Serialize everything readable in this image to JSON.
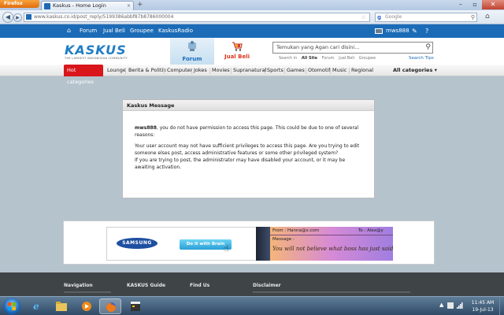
{
  "browser": {
    "menu_button": "Firefox",
    "tab_title": "Kaskus - Home Login",
    "tab_close": "×",
    "new_tab": "+",
    "url": "www.kaskus.co.id/post_reply/5199386abbf87b8786000004",
    "search_placeholder": "Google",
    "search_icon": "search-icon"
  },
  "kaskus": {
    "topnav": [
      "Forum",
      "Jual Beli",
      "Groupee",
      "KaskusRadio"
    ],
    "username": "mws888",
    "logo_text": "KASKUS",
    "logo_tagline": "THE LARGEST INDONESIAN COMMUNITY",
    "tab_forum": "Forum",
    "tab_jualbeli": "Jual Beli",
    "search_placeholder": "Temukan yang Agan cari disini...",
    "search_in_label": "Search in",
    "search_scopes": [
      "All Site",
      "Forum",
      "Jual Beli",
      "Groupee"
    ],
    "search_tips": "Search Tips",
    "hot_categories": "Hot categories",
    "categories": [
      "Lounge",
      "Berita & Politik",
      "Computer",
      "Jokes",
      "Movies",
      "Supranatural",
      "Sports",
      "Games",
      "Otomotif",
      "Music",
      "Regional"
    ],
    "all_categories": "All categories"
  },
  "message": {
    "title": "Kaskus Message",
    "username": "mws888",
    "line1_rest": ", you do not have permission to access this page. This could be due to one of several reasons:",
    "line2": "Your user account may not have sufficient privileges to access this page. Are you trying to edit someone elses post, access administrative features or some other privileged system?",
    "line3": "If you are trying to post, the administrator may have disabled your account, or it may be awaiting activation."
  },
  "ad": {
    "brand": "SAMSUNG",
    "cta": "Do it with Brain",
    "from": "From : Hanna@x.com",
    "to": "To : Alex@y",
    "message_label": "Message :",
    "message_text": "You will not believe what boss has just said..."
  },
  "footer": {
    "headings": [
      "Navigation",
      "KASKUS Guide",
      "Find Us",
      "Disclaimer"
    ]
  },
  "taskbar": {
    "time": "11:45 AM",
    "date": "19-Jul-13"
  },
  "colors": {
    "kaskus_blue": "#1b6bb7",
    "hot_red": "#d8161b",
    "page_bg": "#b5c3cd",
    "footer_bg": "#3f4447"
  }
}
